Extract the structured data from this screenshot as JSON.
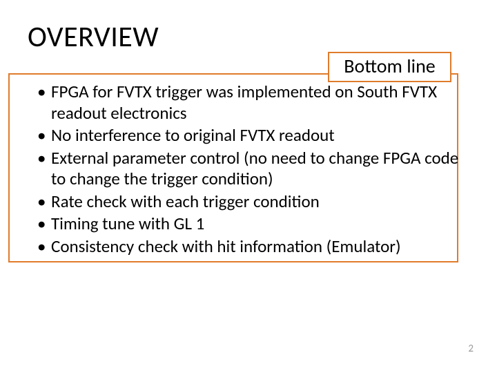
{
  "title": "OVERVIEW",
  "callout": "Bottom line",
  "bullets": [
    "FPGA for FVTX trigger was implemented on South FVTX readout electronics",
    "No interference to original FVTX readout",
    "External parameter control (no need to change FPGA code to change the trigger condition)",
    "Rate check with each trigger condition",
    "Timing tune with GL 1",
    "Consistency check with hit information (Emulator)"
  ],
  "page_number": "2"
}
